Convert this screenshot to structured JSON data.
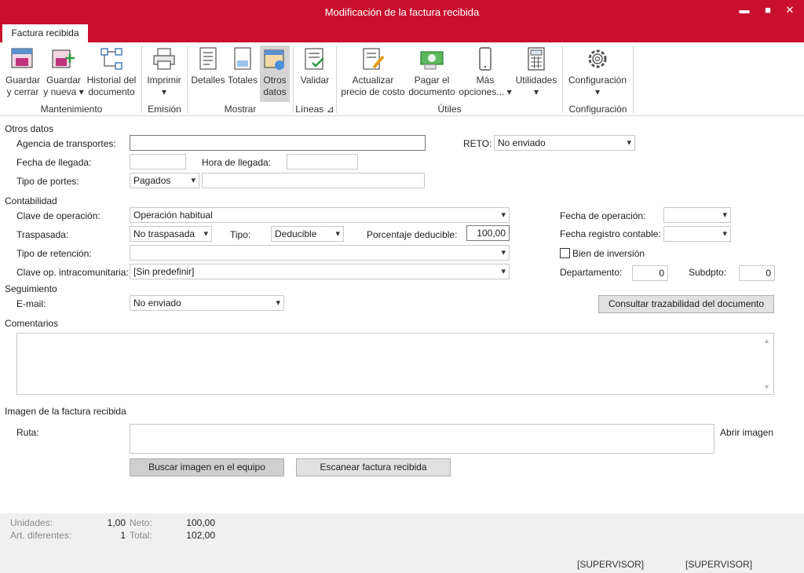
{
  "window": {
    "title": "Modificación de la factura recibida",
    "minimize": "▬",
    "maximize": "■",
    "close": "✕"
  },
  "tabs": [
    {
      "label": "Factura recibida"
    }
  ],
  "ribbon": {
    "buttons": {
      "guardar_cerrar": [
        "Guardar",
        "y cerrar"
      ],
      "guardar_nueva": [
        "Guardar",
        "y nueva ▾"
      ],
      "historial": [
        "Historial del",
        "documento"
      ],
      "imprimir": [
        "Imprimir",
        "▾"
      ],
      "detalles": [
        "Detalles"
      ],
      "totales": [
        "Totales"
      ],
      "otros_datos": [
        "Otros",
        "datos"
      ],
      "validar": [
        "Validar"
      ],
      "actualizar": [
        "Actualizar",
        "precio de costo"
      ],
      "pagar": [
        "Pagar el",
        "documento"
      ],
      "mas": [
        "Más",
        "opciones... ▾"
      ],
      "utilidades": [
        "Utilidades",
        "▾"
      ],
      "configuracion": [
        "Configuración",
        "▾"
      ]
    },
    "groups": {
      "mantenimiento": "Mantenimiento",
      "emision": "Emisión",
      "mostrar": "Mostrar",
      "lineas": "Líneas ⊿",
      "utiles": "Útiles",
      "configuracion": "Configuración"
    }
  },
  "otros_datos": {
    "section": "Otros datos",
    "agencia_label": "Agencia de transportes:",
    "agencia_value": "",
    "reto_label": "RETO:",
    "reto_value": "No enviado",
    "fecha_llegada_label": "Fecha de llegada:",
    "fecha_llegada_value": "",
    "hora_llegada_label": "Hora de llegada:",
    "hora_llegada_value": "",
    "tipo_portes_label": "Tipo de portes:",
    "tipo_portes_value": "Pagados",
    "tipo_portes_extra": ""
  },
  "contabilidad": {
    "section": "Contabilidad",
    "clave_operacion_label": "Clave de operación:",
    "clave_operacion_value": "Operación habitual",
    "fecha_operacion_label": "Fecha de operación:",
    "fecha_operacion_value": "",
    "traspasada_label": "Traspasada:",
    "traspasada_value": "No traspasada",
    "tipo_label": "Tipo:",
    "tipo_value": "Deducible",
    "porcentaje_label": "Porcentaje deducible:",
    "porcentaje_value": "100,00",
    "fecha_registro_label": "Fecha registro contable:",
    "fecha_registro_value": "",
    "tipo_retencion_label": "Tipo de retención:",
    "tipo_retencion_value": "",
    "bien_inversion_label": "Bien de inversión",
    "clave_intra_label": "Clave op. intracomunitaria:",
    "clave_intra_value": "[Sin predefinir]",
    "departamento_label": "Departamento:",
    "departamento_value": "0",
    "subdpto_label": "Subdpto:",
    "subdpto_value": "0"
  },
  "seguimiento": {
    "section": "Seguimiento",
    "email_label": "E-mail:",
    "email_value": "No enviado",
    "trazabilidad_button": "Consultar trazabilidad del documento"
  },
  "comentarios": {
    "section": "Comentarios",
    "value": ""
  },
  "imagen": {
    "section": "Imagen de la factura recibida",
    "ruta_label": "Ruta:",
    "ruta_value": "",
    "abrir": "Abrir imagen",
    "buscar_button": "Buscar imagen en el equipo",
    "escanear_button": "Escanear factura recibida"
  },
  "footer": {
    "unidades_label": "Unidades:",
    "unidades_value": "1,00",
    "art_label": "Art. diferentes:",
    "art_value": "1",
    "neto_label": "Neto:",
    "neto_value": "100,00",
    "total_label": "Total:",
    "total_value": "102,00",
    "user1": "[SUPERVISOR]",
    "user2": "[SUPERVISOR]"
  }
}
